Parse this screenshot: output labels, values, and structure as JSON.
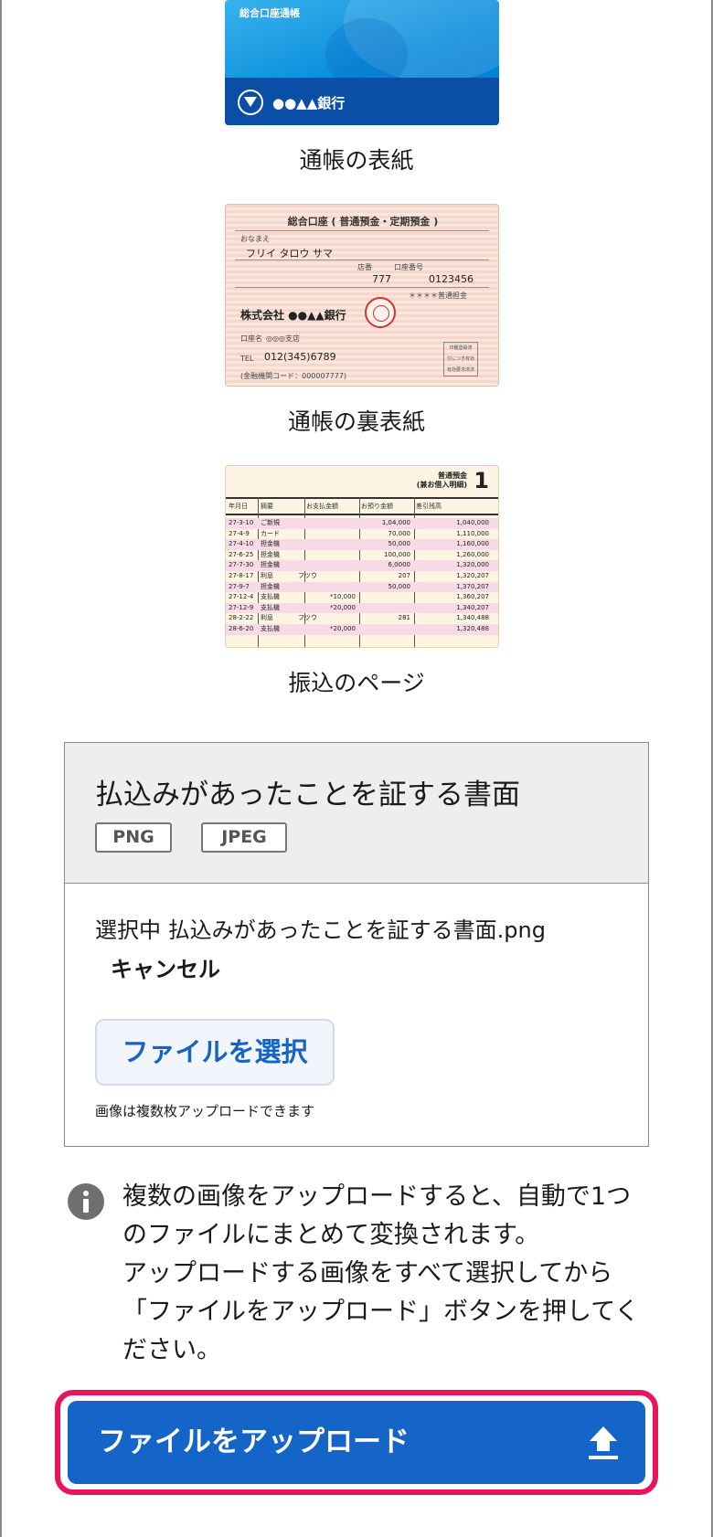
{
  "samples": {
    "cover": {
      "title": "総合口座通帳",
      "bank": "●●▲▲銀行",
      "caption": "通帳の表紙"
    },
    "back_cover": {
      "heading": "総合口座 ( 普通預金・定期預金 )",
      "name_label": "おなまえ",
      "name": "フリイ タロウ サマ",
      "branch_no_label": "店番",
      "branch_no": "777",
      "account_no_label": "口座番号",
      "account_no": "0123456",
      "account_type": "＊＊＊＊普通担金",
      "company": "株式会社 ●●▲▲銀行",
      "branch_label": "口座名",
      "branch": "◎◎◎支店",
      "tel_label": "TEL",
      "tel": "012(345)6789",
      "bank_code": "(金融機関コード：000007777)",
      "box_lines": [
        "印鑑登録済",
        "付につき有効",
        "有効要求済済"
      ],
      "caption": "通帳の裏表紙"
    },
    "ledger": {
      "header": "普通預金\n(兼お借入明細)",
      "page": "1",
      "columns": [
        "年月日",
        "摘要",
        "お支払金額",
        "お預り金額",
        "差引残高"
      ],
      "rows": [
        [
          "27-3-10",
          "ご新規",
          "",
          "1,04,000",
          "1,040,000"
        ],
        [
          "27-4-9",
          "カード",
          "",
          "70,000",
          "1,110,000"
        ],
        [
          "27-4-10",
          "担金機",
          "",
          "50,000",
          "1,160,000"
        ],
        [
          "27-6-25",
          "担金機",
          "",
          "100,000",
          "1,260,000"
        ],
        [
          "27-7-30",
          "担金機",
          "",
          "6,0000",
          "1,320,000"
        ],
        [
          "27-8-17",
          "利息",
          "フツウ",
          "207",
          "1,320,207"
        ],
        [
          "27-9-7",
          "担金機",
          "",
          "50,000",
          "1,370,207"
        ],
        [
          "27-12-4",
          "支払機",
          "*10,000",
          "",
          "1,360,207"
        ],
        [
          "27-12-9",
          "支払機",
          "*20,000",
          "",
          "1,340,207"
        ],
        [
          "28-2-22",
          "利息",
          "フツウ",
          "281",
          "1,340,488"
        ],
        [
          "28-6-20",
          "支払機",
          "*20,000",
          "",
          "1,320,488"
        ]
      ],
      "caption": "振込のページ"
    }
  },
  "upload_card": {
    "title": "払込みがあったことを証する書面",
    "formats": [
      "PNG",
      "JPEG"
    ],
    "selected_prefix": "選択中",
    "selected_file": "払込みがあったことを証する書面.png",
    "cancel_label": "キャンセル",
    "choose_label": "ファイルを選択",
    "hint": "画像は複数枚アップロードできます"
  },
  "note": {
    "line1": "複数の画像をアップロードすると、自動で1つのファイルにまとめて変換されます。",
    "line2": "アップロードする画像をすべて選択してから「ファイルをアップロード」ボタンを押してください。"
  },
  "upload_button": {
    "label": "ファイルをアップロード"
  },
  "colors": {
    "primary": "#1565c9",
    "highlight": "#e8145c",
    "card_header_bg": "#efeeec"
  }
}
